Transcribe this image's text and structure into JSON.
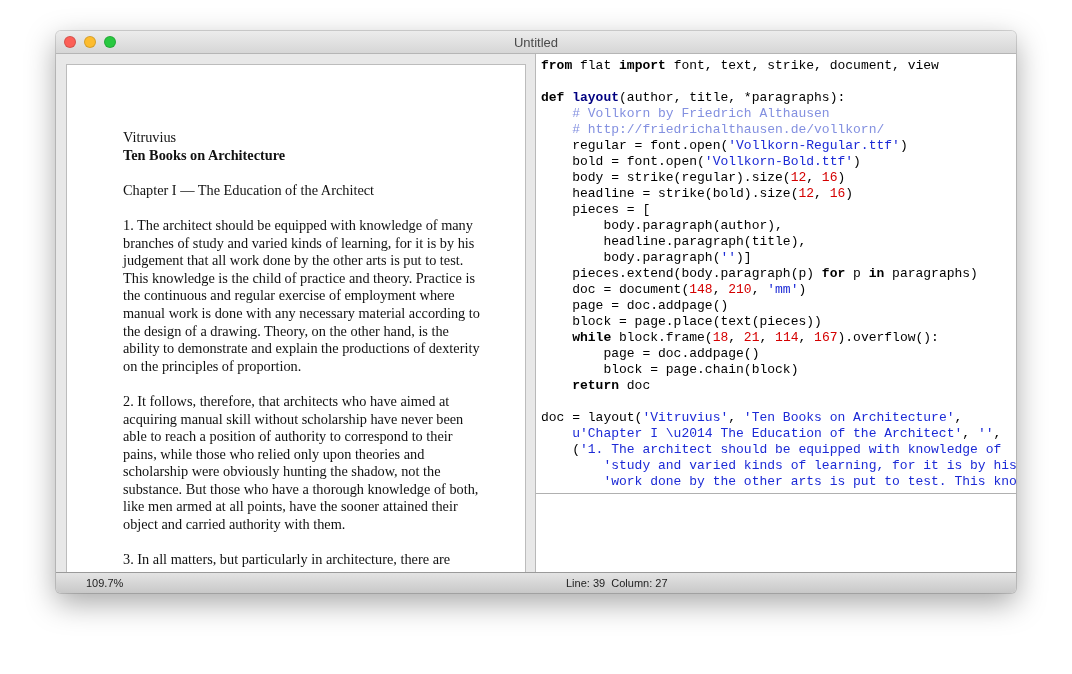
{
  "window": {
    "title": "Untitled"
  },
  "document": {
    "author": "Vitruvius",
    "title": "Ten Books on Architecture",
    "paragraphs": [
      "Chapter I — The Education of the Architect",
      "1. The architect should be equipped with knowledge of many branches of study and varied kinds of learning, for it is by his judgement that all work done by the other arts is put to test. This knowledge is the child of practice and theory. Practice is the continuous and regular exercise of employment where manual work is done with any necessary material according to the design of a drawing. Theory, on the other hand, is the ability to demonstrate and explain the productions of dexterity on the principles of proportion.",
      "2. It follows, therefore, that architects who have aimed at acquiring manual skill without scholarship have never been able to reach a position of authority to correspond to their pains, while those who relied only upon theories and scholarship were obviously hunting the shadow, not the substance. But those who have a thorough knowledge of both, like men armed at all points, have the sooner attained their object and carried authority with them.",
      "3. In all matters, but particularly in architecture, there are"
    ]
  },
  "editor": {
    "lines": [
      [
        {
          "kind": "keyword",
          "text": "from"
        },
        {
          "kind": "plain",
          "text": " flat "
        },
        {
          "kind": "keyword",
          "text": "import"
        },
        {
          "kind": "plain",
          "text": " font, text, strike, document, view"
        },
        {
          "kind": "blank_line"
        }
      ],
      [
        {
          "kind": "keyword",
          "text": "def "
        },
        {
          "kind": "name",
          "text": "layout"
        },
        {
          "kind": "plain",
          "text": "(author, title, *paragraphs):"
        }
      ],
      [
        {
          "kind": "comment",
          "text": "    # Vollkorn by Friedrich Althausen"
        }
      ],
      [
        {
          "kind": "comment",
          "text": "    # http://friedrichalthausen.de/vollkorn/"
        }
      ],
      [
        {
          "kind": "plain",
          "text": "    regular = font.open("
        },
        {
          "kind": "string",
          "text": "'Vollkorn-Regular.ttf'"
        },
        {
          "kind": "plain",
          "text": ")"
        }
      ],
      [
        {
          "kind": "plain",
          "text": "    bold = font.open("
        },
        {
          "kind": "string",
          "text": "'Vollkorn-Bold.ttf'"
        },
        {
          "kind": "plain",
          "text": ")"
        }
      ],
      [
        {
          "kind": "plain",
          "text": "    body = strike(regular).size("
        },
        {
          "kind": "number",
          "text": "12"
        },
        {
          "kind": "plain",
          "text": ", "
        },
        {
          "kind": "number",
          "text": "16"
        },
        {
          "kind": "plain",
          "text": ")"
        }
      ],
      [
        {
          "kind": "plain",
          "text": "    headline = strike(bold).size("
        },
        {
          "kind": "number",
          "text": "12"
        },
        {
          "kind": "plain",
          "text": ", "
        },
        {
          "kind": "number",
          "text": "16"
        },
        {
          "kind": "plain",
          "text": ")"
        }
      ],
      [
        {
          "kind": "plain",
          "text": "    pieces = ["
        }
      ],
      [
        {
          "kind": "plain",
          "text": "        body.paragraph(author),"
        }
      ],
      [
        {
          "kind": "plain",
          "text": "        headline.paragraph(title),"
        }
      ],
      [
        {
          "kind": "plain",
          "text": "        body.paragraph("
        },
        {
          "kind": "string",
          "text": "''"
        },
        {
          "kind": "plain",
          "text": ")]"
        }
      ],
      [
        {
          "kind": "plain",
          "text": "    pieces.extend(body.paragraph(p) "
        },
        {
          "kind": "keyword",
          "text": "for"
        },
        {
          "kind": "plain",
          "text": " p "
        },
        {
          "kind": "keyword",
          "text": "in"
        },
        {
          "kind": "plain",
          "text": " paragraphs)"
        }
      ],
      [
        {
          "kind": "plain",
          "text": "    doc = document("
        },
        {
          "kind": "number",
          "text": "148"
        },
        {
          "kind": "plain",
          "text": ", "
        },
        {
          "kind": "number",
          "text": "210"
        },
        {
          "kind": "plain",
          "text": ", "
        },
        {
          "kind": "string",
          "text": "'mm'"
        },
        {
          "kind": "plain",
          "text": ")"
        }
      ],
      [
        {
          "kind": "plain",
          "text": "    page = doc.addpage()"
        }
      ],
      [
        {
          "kind": "plain",
          "text": "    block = page.place(text(pieces))"
        }
      ],
      [
        {
          "kind": "keyword",
          "text": "    while"
        },
        {
          "kind": "plain",
          "text": " block.frame("
        },
        {
          "kind": "number",
          "text": "18"
        },
        {
          "kind": "plain",
          "text": ", "
        },
        {
          "kind": "number",
          "text": "21"
        },
        {
          "kind": "plain",
          "text": ", "
        },
        {
          "kind": "number",
          "text": "114"
        },
        {
          "kind": "plain",
          "text": ", "
        },
        {
          "kind": "number",
          "text": "167"
        },
        {
          "kind": "plain",
          "text": ").overflow():"
        }
      ],
      [
        {
          "kind": "plain",
          "text": "        page = doc.addpage()"
        }
      ],
      [
        {
          "kind": "plain",
          "text": "        block = page.chain(block)"
        }
      ],
      [
        {
          "kind": "keyword",
          "text": "    return"
        },
        {
          "kind": "plain",
          "text": " doc"
        },
        {
          "kind": "blank_line"
        }
      ],
      [
        {
          "kind": "plain",
          "text": "doc = layout("
        },
        {
          "kind": "string",
          "text": "'Vitruvius'"
        },
        {
          "kind": "plain",
          "text": ", "
        },
        {
          "kind": "string",
          "text": "'Ten Books on Architecture'"
        },
        {
          "kind": "plain",
          "text": ","
        }
      ],
      [
        {
          "kind": "string",
          "text": "    u'Chapter I \\u2014 The Education of the Architect'"
        },
        {
          "kind": "plain",
          "text": ", "
        },
        {
          "kind": "string",
          "text": "''"
        },
        {
          "kind": "plain",
          "text": ","
        }
      ],
      [
        {
          "kind": "plain",
          "text": "    ("
        },
        {
          "kind": "string",
          "text": "'1. The architect should be equipped with knowledge of"
        }
      ],
      [
        {
          "kind": "string",
          "text": "        'study and varied kinds of learning, for it is by his"
        }
      ],
      [
        {
          "kind": "string",
          "text": "        'work done by the other arts is put to test. This kno"
        }
      ]
    ]
  },
  "status_bar": {
    "zoom": "109.7%",
    "position": "Line: 39  Column: 27"
  }
}
